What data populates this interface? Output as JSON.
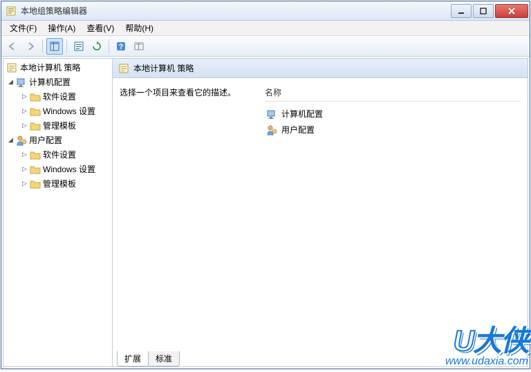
{
  "window": {
    "title": "本地组策略编辑器"
  },
  "menu": {
    "file": "文件(F)",
    "action": "操作(A)",
    "view": "查看(V)",
    "help": "帮助(H)"
  },
  "tree": {
    "root": "本地计算机 策略",
    "computer": {
      "label": "计算机配置",
      "children": [
        "软件设置",
        "Windows 设置",
        "管理模板"
      ]
    },
    "user": {
      "label": "用户配置",
      "children": [
        "软件设置",
        "Windows 设置",
        "管理模板"
      ]
    }
  },
  "right": {
    "header": "本地计算机 策略",
    "desc_prompt": "选择一个项目来查看它的描述。",
    "name_col": "名称",
    "items": [
      "计算机配置",
      "用户配置"
    ]
  },
  "tabs": {
    "extended": "扩展",
    "standard": "标准"
  },
  "watermark": {
    "logo_u": "U",
    "logo_rest": "大侠",
    "url": "www.udaxia.com"
  }
}
